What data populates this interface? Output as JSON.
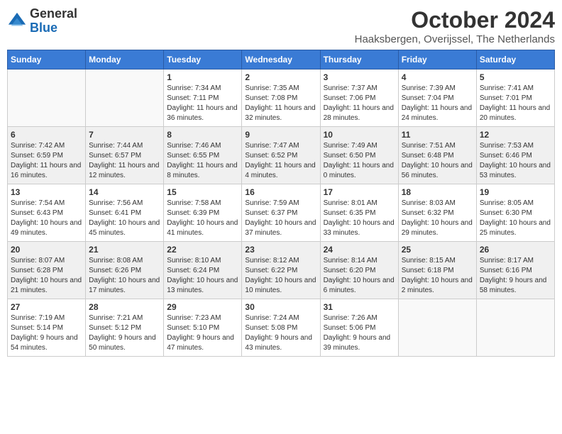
{
  "header": {
    "logo_line1": "General",
    "logo_line2": "Blue",
    "month": "October 2024",
    "location": "Haaksbergen, Overijssel, The Netherlands"
  },
  "weekdays": [
    "Sunday",
    "Monday",
    "Tuesday",
    "Wednesday",
    "Thursday",
    "Friday",
    "Saturday"
  ],
  "weeks": [
    [
      {
        "day": "",
        "info": ""
      },
      {
        "day": "",
        "info": ""
      },
      {
        "day": "1",
        "info": "Sunrise: 7:34 AM\nSunset: 7:11 PM\nDaylight: 11 hours and 36 minutes."
      },
      {
        "day": "2",
        "info": "Sunrise: 7:35 AM\nSunset: 7:08 PM\nDaylight: 11 hours and 32 minutes."
      },
      {
        "day": "3",
        "info": "Sunrise: 7:37 AM\nSunset: 7:06 PM\nDaylight: 11 hours and 28 minutes."
      },
      {
        "day": "4",
        "info": "Sunrise: 7:39 AM\nSunset: 7:04 PM\nDaylight: 11 hours and 24 minutes."
      },
      {
        "day": "5",
        "info": "Sunrise: 7:41 AM\nSunset: 7:01 PM\nDaylight: 11 hours and 20 minutes."
      }
    ],
    [
      {
        "day": "6",
        "info": "Sunrise: 7:42 AM\nSunset: 6:59 PM\nDaylight: 11 hours and 16 minutes."
      },
      {
        "day": "7",
        "info": "Sunrise: 7:44 AM\nSunset: 6:57 PM\nDaylight: 11 hours and 12 minutes."
      },
      {
        "day": "8",
        "info": "Sunrise: 7:46 AM\nSunset: 6:55 PM\nDaylight: 11 hours and 8 minutes."
      },
      {
        "day": "9",
        "info": "Sunrise: 7:47 AM\nSunset: 6:52 PM\nDaylight: 11 hours and 4 minutes."
      },
      {
        "day": "10",
        "info": "Sunrise: 7:49 AM\nSunset: 6:50 PM\nDaylight: 11 hours and 0 minutes."
      },
      {
        "day": "11",
        "info": "Sunrise: 7:51 AM\nSunset: 6:48 PM\nDaylight: 10 hours and 56 minutes."
      },
      {
        "day": "12",
        "info": "Sunrise: 7:53 AM\nSunset: 6:46 PM\nDaylight: 10 hours and 53 minutes."
      }
    ],
    [
      {
        "day": "13",
        "info": "Sunrise: 7:54 AM\nSunset: 6:43 PM\nDaylight: 10 hours and 49 minutes."
      },
      {
        "day": "14",
        "info": "Sunrise: 7:56 AM\nSunset: 6:41 PM\nDaylight: 10 hours and 45 minutes."
      },
      {
        "day": "15",
        "info": "Sunrise: 7:58 AM\nSunset: 6:39 PM\nDaylight: 10 hours and 41 minutes."
      },
      {
        "day": "16",
        "info": "Sunrise: 7:59 AM\nSunset: 6:37 PM\nDaylight: 10 hours and 37 minutes."
      },
      {
        "day": "17",
        "info": "Sunrise: 8:01 AM\nSunset: 6:35 PM\nDaylight: 10 hours and 33 minutes."
      },
      {
        "day": "18",
        "info": "Sunrise: 8:03 AM\nSunset: 6:32 PM\nDaylight: 10 hours and 29 minutes."
      },
      {
        "day": "19",
        "info": "Sunrise: 8:05 AM\nSunset: 6:30 PM\nDaylight: 10 hours and 25 minutes."
      }
    ],
    [
      {
        "day": "20",
        "info": "Sunrise: 8:07 AM\nSunset: 6:28 PM\nDaylight: 10 hours and 21 minutes."
      },
      {
        "day": "21",
        "info": "Sunrise: 8:08 AM\nSunset: 6:26 PM\nDaylight: 10 hours and 17 minutes."
      },
      {
        "day": "22",
        "info": "Sunrise: 8:10 AM\nSunset: 6:24 PM\nDaylight: 10 hours and 13 minutes."
      },
      {
        "day": "23",
        "info": "Sunrise: 8:12 AM\nSunset: 6:22 PM\nDaylight: 10 hours and 10 minutes."
      },
      {
        "day": "24",
        "info": "Sunrise: 8:14 AM\nSunset: 6:20 PM\nDaylight: 10 hours and 6 minutes."
      },
      {
        "day": "25",
        "info": "Sunrise: 8:15 AM\nSunset: 6:18 PM\nDaylight: 10 hours and 2 minutes."
      },
      {
        "day": "26",
        "info": "Sunrise: 8:17 AM\nSunset: 6:16 PM\nDaylight: 9 hours and 58 minutes."
      }
    ],
    [
      {
        "day": "27",
        "info": "Sunrise: 7:19 AM\nSunset: 5:14 PM\nDaylight: 9 hours and 54 minutes."
      },
      {
        "day": "28",
        "info": "Sunrise: 7:21 AM\nSunset: 5:12 PM\nDaylight: 9 hours and 50 minutes."
      },
      {
        "day": "29",
        "info": "Sunrise: 7:23 AM\nSunset: 5:10 PM\nDaylight: 9 hours and 47 minutes."
      },
      {
        "day": "30",
        "info": "Sunrise: 7:24 AM\nSunset: 5:08 PM\nDaylight: 9 hours and 43 minutes."
      },
      {
        "day": "31",
        "info": "Sunrise: 7:26 AM\nSunset: 5:06 PM\nDaylight: 9 hours and 39 minutes."
      },
      {
        "day": "",
        "info": ""
      },
      {
        "day": "",
        "info": ""
      }
    ]
  ]
}
